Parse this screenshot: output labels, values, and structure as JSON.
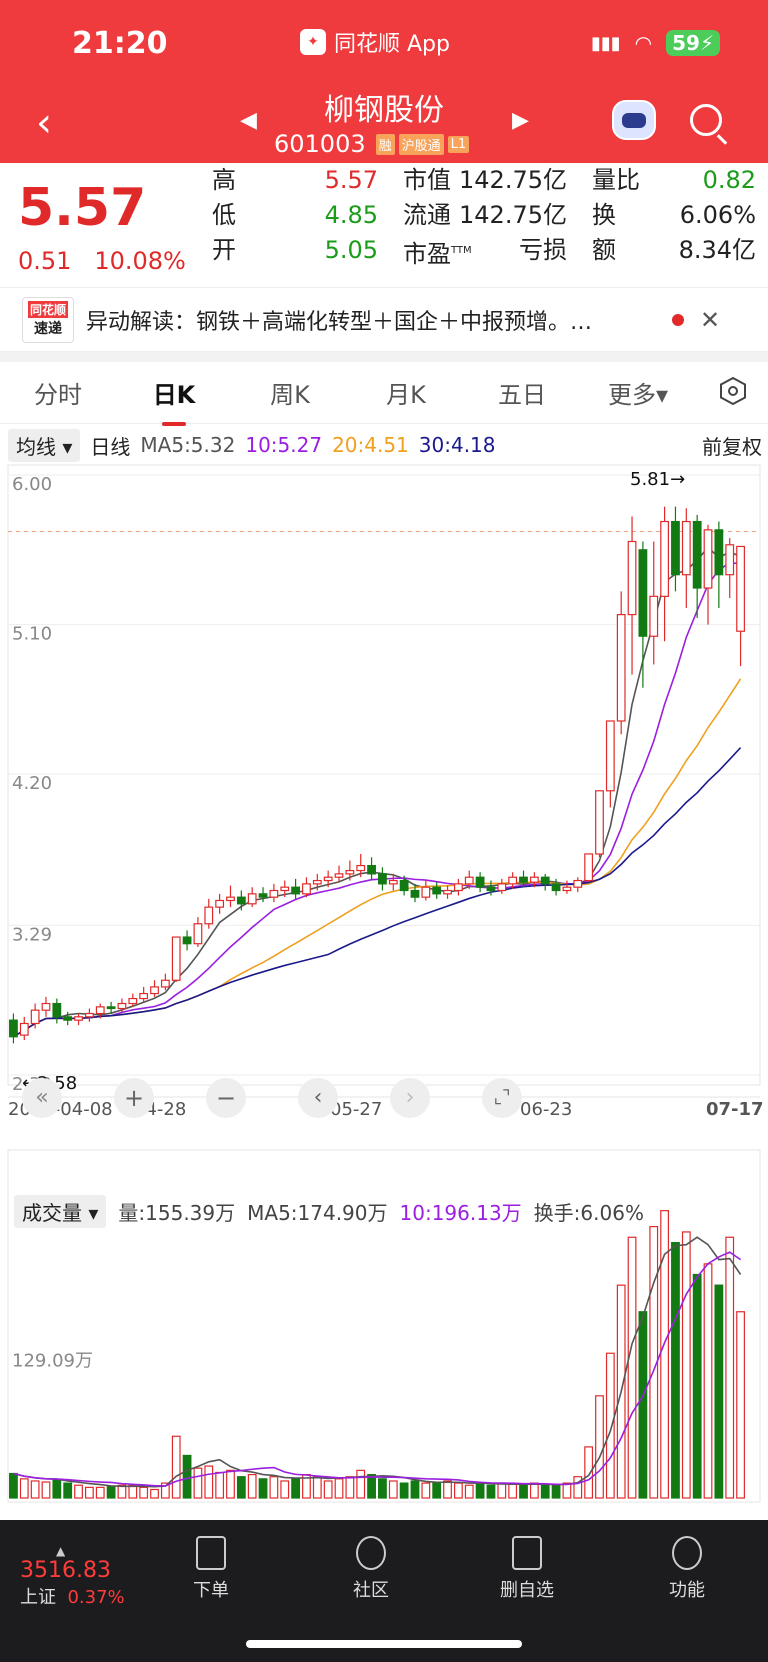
{
  "status_bar": {
    "time": "21:20",
    "app": "同花顺 App",
    "battery": "59"
  },
  "header": {
    "title": "柳钢股份",
    "code": "601003",
    "tags": [
      "融",
      "沪股通",
      "L1"
    ]
  },
  "quote": {
    "price": "5.57",
    "change": "0.51",
    "change_pct": "10.08%",
    "col1": [
      {
        "label": "高",
        "value": "5.57"
      },
      {
        "label": "低",
        "value": "4.85"
      },
      {
        "label": "开",
        "value": "5.05"
      }
    ],
    "col2": [
      {
        "label": "市值",
        "value": "142.75亿"
      },
      {
        "label": "流通",
        "value": "142.75亿"
      },
      {
        "label": "市盈",
        "sup": "TTM",
        "value": "亏损"
      }
    ],
    "col3": [
      {
        "label": "量比",
        "value": "0.82"
      },
      {
        "label": "换",
        "value": "6.06%"
      },
      {
        "label": "额",
        "value": "8.34亿"
      }
    ]
  },
  "news": {
    "logo_top": "同花顺",
    "logo_bottom": "速递",
    "text": "异动解读：钢铁＋高端化转型＋国企＋中报预增。…"
  },
  "tabs": [
    "分时",
    "日K",
    "周K",
    "月K",
    "五日",
    "更多▾"
  ],
  "ma_legend": {
    "selector": "均线 ▾",
    "period": "日线",
    "ma5": "MA5:5.32",
    "ma10": "10:5.27",
    "ma20": "20:4.51",
    "ma30": "30:4.18",
    "adjust": "前复权"
  },
  "price_axis": [
    "6.00",
    "5.10",
    "4.20",
    "3.29",
    "2.39"
  ],
  "price_marks": {
    "high": "5.81→",
    "low": "←2.58"
  },
  "date_axis": [
    "2025-04-08",
    "04-28",
    "05-27",
    "06-23",
    "07-17"
  ],
  "volume_legend": {
    "selector": "成交量 ▾",
    "vol": "量:155.39万",
    "ma5": "MA5:174.90万",
    "ma10": "10:196.13万",
    "turnover": "换手:6.06%"
  },
  "volume_axis": "129.09万",
  "bottom_bar": {
    "index_value": "3516.83",
    "index_name": "上证",
    "index_pct": "0.37%",
    "items": [
      "下单",
      "社区",
      "删自选",
      "功能"
    ]
  },
  "colors": {
    "up": "#e02a2a",
    "down": "#137a13",
    "ma5": "#555555",
    "ma10": "#9b1fe0",
    "ma20": "#f0a01e",
    "ma30": "#1a1a8c"
  },
  "chart_data": {
    "type": "candlestick",
    "ylim": [
      2.39,
      6.0
    ],
    "candles": [
      [
        2.72,
        2.62,
        2.76,
        2.58
      ],
      [
        2.63,
        2.7,
        2.74,
        2.6
      ],
      [
        2.7,
        2.78,
        2.82,
        2.67
      ],
      [
        2.78,
        2.82,
        2.86,
        2.74
      ],
      [
        2.82,
        2.74,
        2.85,
        2.7
      ],
      [
        2.74,
        2.72,
        2.77,
        2.69
      ],
      [
        2.72,
        2.74,
        2.76,
        2.69
      ],
      [
        2.74,
        2.76,
        2.79,
        2.71
      ],
      [
        2.76,
        2.8,
        2.82,
        2.73
      ],
      [
        2.8,
        2.79,
        2.83,
        2.76
      ],
      [
        2.79,
        2.82,
        2.85,
        2.77
      ],
      [
        2.82,
        2.85,
        2.88,
        2.8
      ],
      [
        2.85,
        2.88,
        2.92,
        2.83
      ],
      [
        2.88,
        2.92,
        2.96,
        2.86
      ],
      [
        2.92,
        2.96,
        3.0,
        2.9
      ],
      [
        2.96,
        3.22,
        3.22,
        2.95
      ],
      [
        3.22,
        3.18,
        3.26,
        3.14
      ],
      [
        3.18,
        3.3,
        3.34,
        3.16
      ],
      [
        3.3,
        3.4,
        3.45,
        3.27
      ],
      [
        3.4,
        3.44,
        3.48,
        3.36
      ],
      [
        3.44,
        3.46,
        3.53,
        3.4
      ],
      [
        3.46,
        3.42,
        3.5,
        3.38
      ],
      [
        3.42,
        3.48,
        3.52,
        3.4
      ],
      [
        3.48,
        3.46,
        3.52,
        3.43
      ],
      [
        3.46,
        3.5,
        3.54,
        3.43
      ],
      [
        3.5,
        3.52,
        3.56,
        3.46
      ],
      [
        3.52,
        3.48,
        3.57,
        3.45
      ],
      [
        3.48,
        3.54,
        3.58,
        3.46
      ],
      [
        3.54,
        3.56,
        3.6,
        3.5
      ],
      [
        3.56,
        3.58,
        3.62,
        3.52
      ],
      [
        3.58,
        3.6,
        3.65,
        3.55
      ],
      [
        3.6,
        3.62,
        3.68,
        3.56
      ],
      [
        3.62,
        3.65,
        3.72,
        3.58
      ],
      [
        3.65,
        3.6,
        3.7,
        3.56
      ],
      [
        3.6,
        3.54,
        3.64,
        3.5
      ],
      [
        3.54,
        3.56,
        3.6,
        3.5
      ],
      [
        3.56,
        3.5,
        3.59,
        3.47
      ],
      [
        3.5,
        3.46,
        3.54,
        3.43
      ],
      [
        3.46,
        3.52,
        3.56,
        3.44
      ],
      [
        3.52,
        3.48,
        3.55,
        3.45
      ],
      [
        3.48,
        3.5,
        3.53,
        3.45
      ],
      [
        3.5,
        3.54,
        3.57,
        3.47
      ],
      [
        3.54,
        3.58,
        3.62,
        3.51
      ],
      [
        3.58,
        3.52,
        3.61,
        3.49
      ],
      [
        3.52,
        3.5,
        3.56,
        3.47
      ],
      [
        3.5,
        3.54,
        3.57,
        3.48
      ],
      [
        3.54,
        3.58,
        3.61,
        3.51
      ],
      [
        3.58,
        3.55,
        3.62,
        3.52
      ],
      [
        3.55,
        3.58,
        3.61,
        3.52
      ],
      [
        3.58,
        3.54,
        3.6,
        3.5
      ],
      [
        3.54,
        3.5,
        3.57,
        3.47
      ],
      [
        3.5,
        3.52,
        3.56,
        3.48
      ],
      [
        3.52,
        3.56,
        3.58,
        3.49
      ],
      [
        3.56,
        3.72,
        3.72,
        3.55
      ],
      [
        3.72,
        4.1,
        4.1,
        3.7
      ],
      [
        4.1,
        4.52,
        4.52,
        4.0
      ],
      [
        4.52,
        5.16,
        5.3,
        4.44
      ],
      [
        5.16,
        5.6,
        5.75,
        4.8
      ],
      [
        5.55,
        5.03,
        5.6,
        4.72
      ],
      [
        5.03,
        5.27,
        5.6,
        4.86
      ],
      [
        5.27,
        5.72,
        5.81,
        5.0
      ],
      [
        5.72,
        5.4,
        5.81,
        5.3
      ],
      [
        5.4,
        5.72,
        5.8,
        5.2
      ],
      [
        5.72,
        5.32,
        5.76,
        5.14
      ],
      [
        5.32,
        5.67,
        5.7,
        5.1
      ],
      [
        5.67,
        5.4,
        5.72,
        5.2
      ],
      [
        5.4,
        5.58,
        5.62,
        5.26
      ],
      [
        5.06,
        5.57,
        5.57,
        4.85
      ]
    ],
    "volumes": [
      23,
      18,
      16,
      15,
      17,
      14,
      12,
      10,
      10,
      11,
      12,
      12,
      10,
      8,
      14,
      58,
      40,
      28,
      30,
      24,
      26,
      20,
      22,
      18,
      20,
      16,
      18,
      22,
      20,
      16,
      18,
      20,
      26,
      22,
      18,
      16,
      14,
      16,
      14,
      14,
      16,
      14,
      12,
      14,
      12,
      14,
      13,
      12,
      14,
      12,
      12,
      14,
      20,
      48,
      96,
      136,
      200,
      245,
      175,
      255,
      270,
      240,
      250,
      210,
      220,
      200,
      245,
      175
    ]
  }
}
